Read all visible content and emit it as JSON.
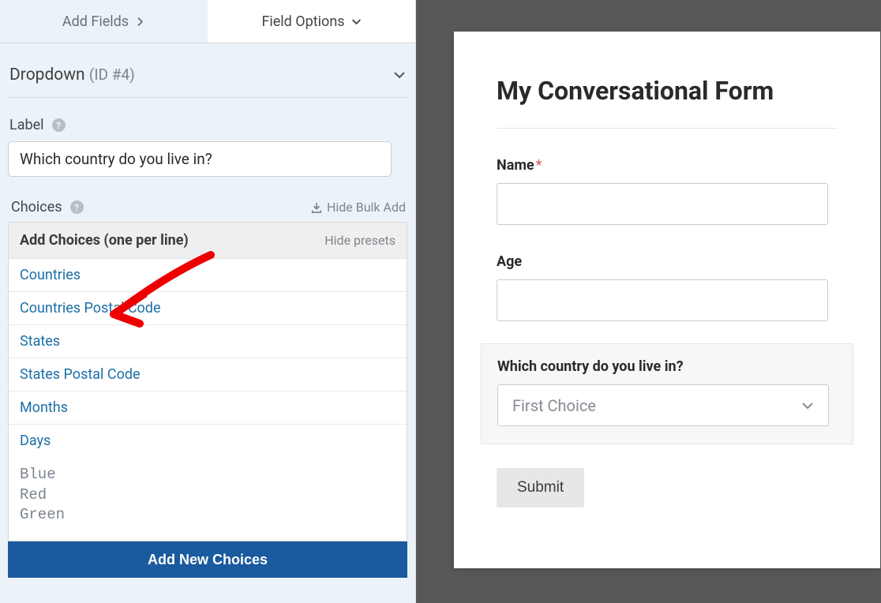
{
  "tabs": {
    "add_fields": "Add Fields",
    "field_options": "Field Options"
  },
  "section": {
    "title_text": "Dropdown",
    "id_text": "(ID #4)"
  },
  "label_field": {
    "title": "Label",
    "value": "Which country do you live in?"
  },
  "choices": {
    "title": "Choices",
    "hide_bulk": "Hide Bulk Add",
    "add_choices_heading": "Add Choices (one per line)",
    "hide_presets": "Hide presets",
    "presets": [
      "Countries",
      "Countries Postal Code",
      "States",
      "States Postal Code",
      "Months",
      "Days"
    ],
    "textarea_value": "Blue\nRed\nGreen",
    "add_button": "Add New Choices"
  },
  "preview": {
    "form_title": "My Conversational Form",
    "name_label": "Name",
    "required_mark": "*",
    "age_label": "Age",
    "dropdown_label": "Which country do you live in?",
    "dropdown_value": "First Choice",
    "submit": "Submit"
  },
  "colors": {
    "accent": "#1a5a9e",
    "link": "#1b6fa5"
  }
}
